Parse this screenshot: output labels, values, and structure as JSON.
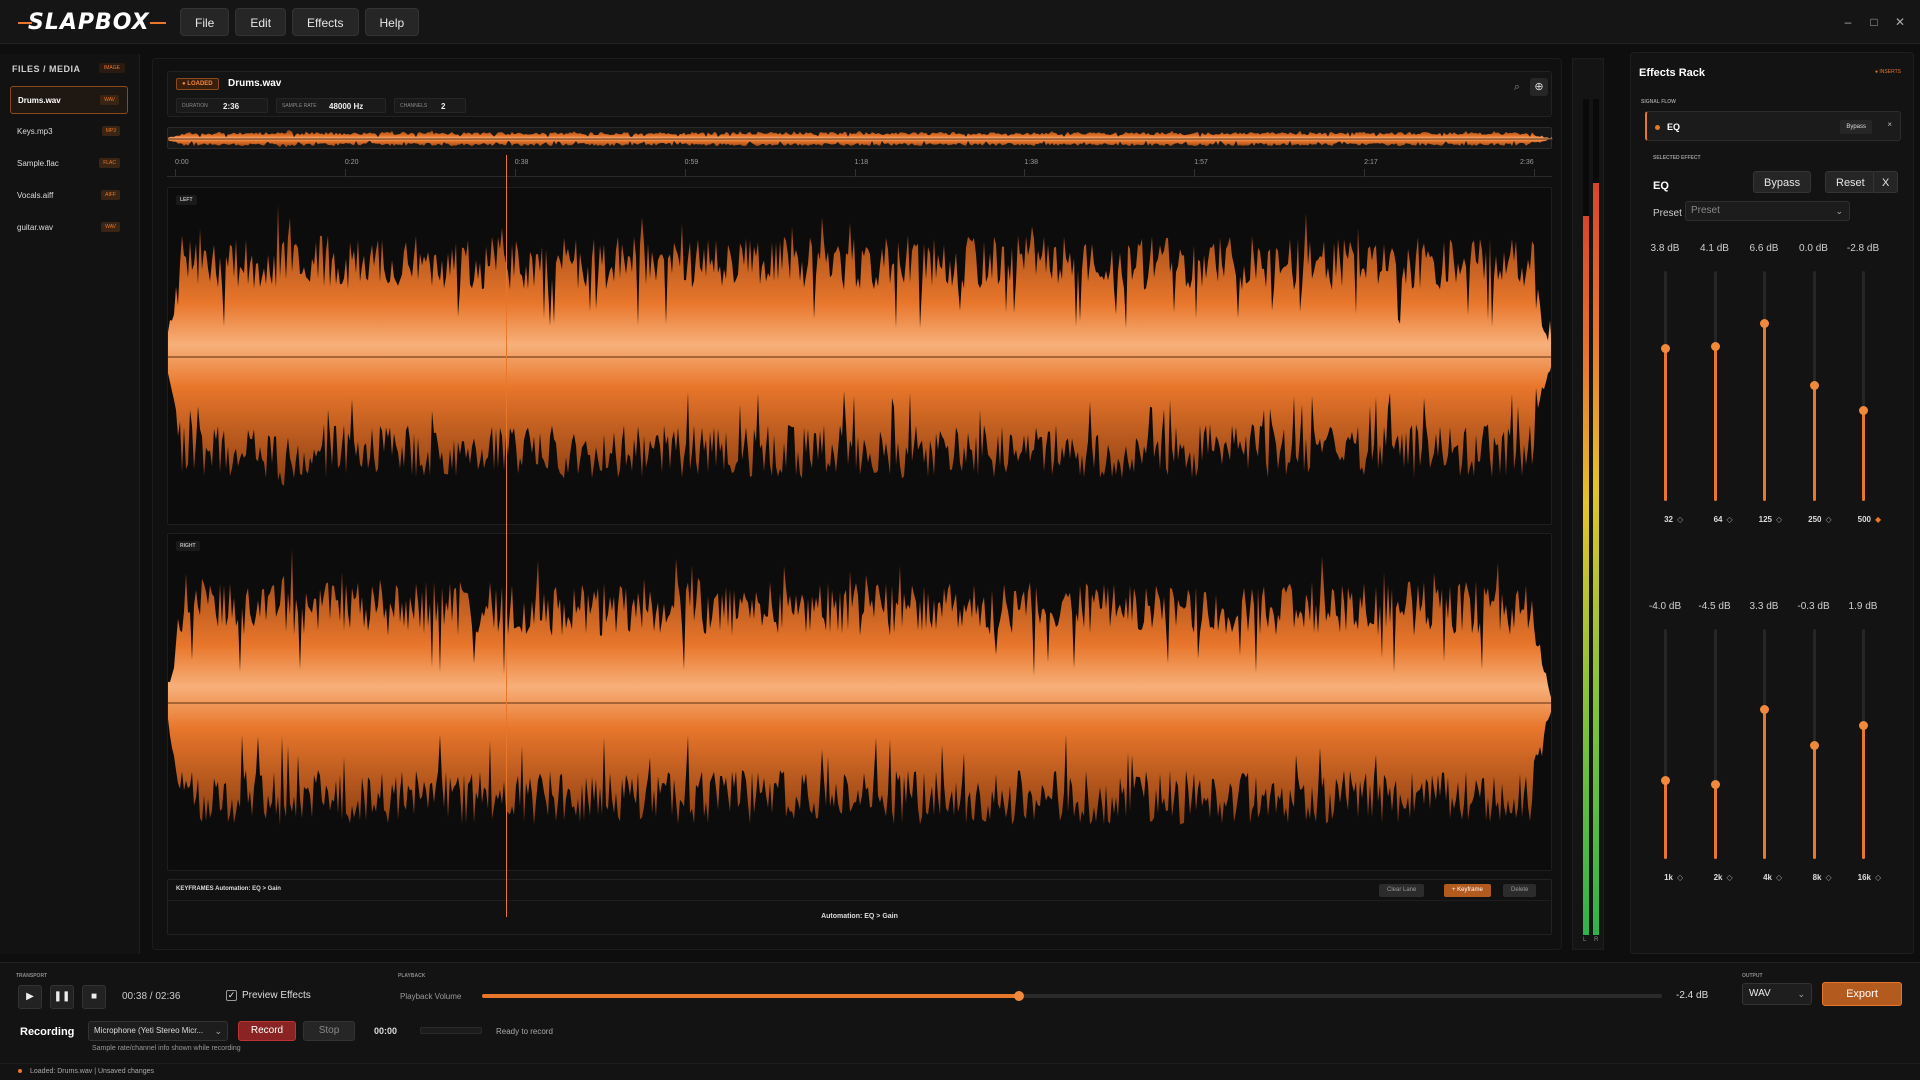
{
  "app": {
    "logo_text": "SLAPBOX"
  },
  "menu": [
    "File",
    "Edit",
    "Effects",
    "Help"
  ],
  "window_controls": [
    "–",
    "□",
    "✕"
  ],
  "sidebar": {
    "title": "FILES / MEDIA",
    "badge": "IMAGE",
    "files": [
      {
        "name": "Drums.wav",
        "tag": "WAV",
        "active": true
      },
      {
        "name": "Keys.mp3",
        "tag": "MP3",
        "active": false
      },
      {
        "name": "Sample.flac",
        "tag": "FLAC",
        "active": false
      },
      {
        "name": "Vocals.aiff",
        "tag": "AIFF",
        "active": false
      },
      {
        "name": "guitar.wav",
        "tag": "WAV",
        "active": false
      }
    ]
  },
  "editor": {
    "loaded_pill": "● LOADED",
    "filename": "Drums.wav",
    "meta": [
      {
        "label": "DURATION",
        "value": "2:36"
      },
      {
        "label": "SAMPLE RATE",
        "value": "48000 Hz"
      },
      {
        "label": "CHANNELS",
        "value": "2"
      }
    ],
    "ruler_ticks": [
      "0:00",
      "0:20",
      "0:38",
      "0:59",
      "1:18",
      "1:38",
      "1:57",
      "2:17",
      "2:36"
    ],
    "tracks": [
      {
        "label": "LEFT"
      },
      {
        "label": "RIGHT"
      }
    ],
    "playhead_fraction": 0.245,
    "keyframes": {
      "title": "KEYFRAMES   Automation: EQ > Gain",
      "lane_label": "Automation: EQ > Gain",
      "buttons": [
        "Clear Lane",
        "+ Keyframe",
        "Delete"
      ]
    }
  },
  "meters": {
    "left_level": 0.86,
    "right_level": 0.9,
    "labels": [
      "L",
      "R"
    ]
  },
  "rack": {
    "title": "Effects Rack",
    "inserts_label": "● INSERTS",
    "signal_flow_label": "SIGNAL FLOW",
    "slot": {
      "name": "EQ",
      "bypass": "Bypass",
      "close": "×"
    },
    "selected_label": "SELECTED EFFECT",
    "effect_name": "EQ",
    "buttons": [
      "Bypass",
      "Reset",
      "X"
    ],
    "preset_label": "Preset",
    "preset_value": "Preset",
    "bands_top": [
      {
        "gain": "3.8 dB",
        "freq": "32",
        "level": 0.66,
        "active": false
      },
      {
        "gain": "4.1 dB",
        "freq": "64",
        "level": 0.67,
        "active": false
      },
      {
        "gain": "6.6 dB",
        "freq": "125",
        "level": 0.77,
        "active": false
      },
      {
        "gain": "0.0 dB",
        "freq": "250",
        "level": 0.5,
        "active": false
      },
      {
        "gain": "-2.8 dB",
        "freq": "500",
        "level": 0.39,
        "active": true
      }
    ],
    "bands_bottom": [
      {
        "gain": "-4.0 dB",
        "freq": "1k",
        "level": 0.34,
        "active": false
      },
      {
        "gain": "-4.5 dB",
        "freq": "2k",
        "level": 0.32,
        "active": false
      },
      {
        "gain": "3.3 dB",
        "freq": "4k",
        "level": 0.65,
        "active": false
      },
      {
        "gain": "-0.3 dB",
        "freq": "8k",
        "level": 0.49,
        "active": false
      },
      {
        "gain": "1.9 dB",
        "freq": "16k",
        "level": 0.58,
        "active": false
      }
    ],
    "band_diamond": "◇",
    "band_diamond_active": "◆"
  },
  "transport": {
    "section_label": "TRANSPORT",
    "time": "00:38 / 02:36",
    "preview_label": "Preview Effects",
    "preview_checked": true
  },
  "playback": {
    "section_label": "PLAYBACK",
    "volume_label": "Playback Volume",
    "volume_level": 0.455,
    "volume_db": "-2.4 dB"
  },
  "output": {
    "section_label": "OUTPUT",
    "format": "WAV",
    "export_label": "Export"
  },
  "recording": {
    "title": "Recording",
    "device": "Microphone (Yeti Stereo Micr...",
    "record_label": "Record",
    "stop_label": "Stop",
    "time": "00:00",
    "status": "Ready to record",
    "note": "Sample rate/channel info shown while recording"
  },
  "statusbar": {
    "text": "Loaded: Drums.wav  |  Unsaved changes"
  },
  "colors": {
    "accent": "#e8762b",
    "background": "#0e0e0e",
    "record": "#8a2424"
  }
}
